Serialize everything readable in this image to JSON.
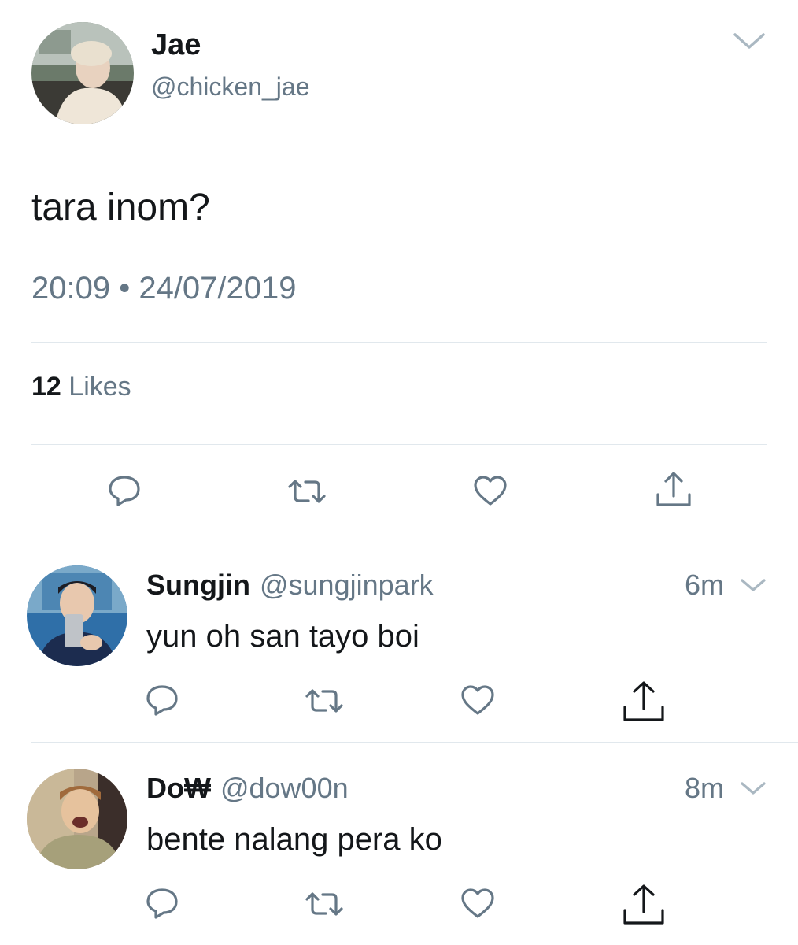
{
  "main_tweet": {
    "author_name": "Jae",
    "author_handle": "@chicken_jae",
    "text": "tara inom?",
    "timestamp": "20:09 • 24/07/2019",
    "likes_count": "12",
    "likes_label": "Likes"
  },
  "replies": [
    {
      "author_name": "Sungjin",
      "author_handle": "@sungjinpark",
      "time": "6m",
      "text": "yun oh san tayo boi"
    },
    {
      "author_name": "Do₩",
      "author_handle": "@dow00n",
      "time": "8m",
      "text": "bente nalang pera ko"
    }
  ],
  "icons": {
    "more": "chevron-down-icon",
    "reply": "reply-icon",
    "retweet": "retweet-icon",
    "like": "heart-icon",
    "share": "share-icon"
  },
  "colors": {
    "text_primary": "#14171a",
    "text_secondary": "#657786",
    "icon": "#657786",
    "divider": "#e1e8ed"
  }
}
